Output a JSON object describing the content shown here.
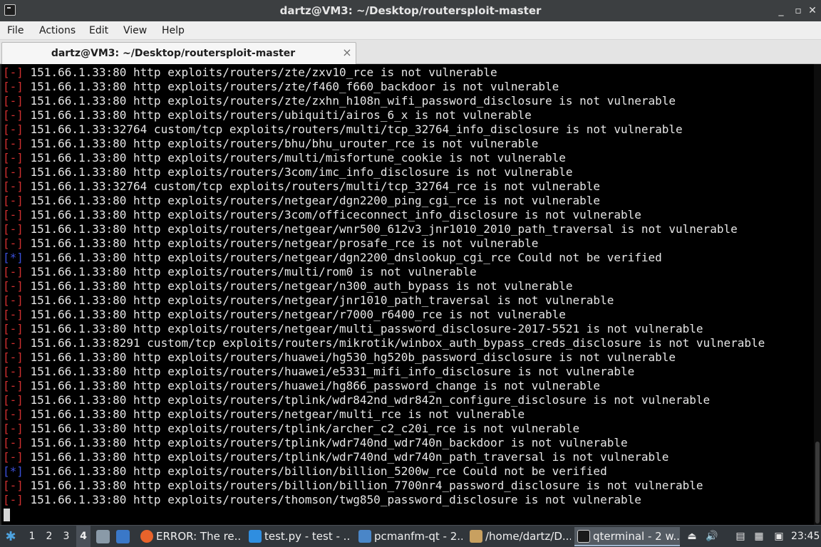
{
  "window": {
    "title": "dartz@VM3: ~/Desktop/routersploit-master",
    "minimize_glyph": "_",
    "maximize_glyph": "▫",
    "close_glyph": "✕"
  },
  "menu": [
    "File",
    "Actions",
    "Edit",
    "View",
    "Help"
  ],
  "tab": {
    "label": "dartz@VM3: ~/Desktop/routersploit-master",
    "close_glyph": "×"
  },
  "terminal": {
    "colors": {
      "error_prefix": "#d03030",
      "info_prefix": "#3a4fd8",
      "text": "#e6e6e6",
      "background": "#000000"
    },
    "lines": [
      {
        "prefix": "[-]",
        "kind": "err",
        "text": " 151.66.1.33:80 http exploits/routers/zte/zxv10_rce is not vulnerable"
      },
      {
        "prefix": "[-]",
        "kind": "err",
        "text": " 151.66.1.33:80 http exploits/routers/zte/f460_f660_backdoor is not vulnerable"
      },
      {
        "prefix": "[-]",
        "kind": "err",
        "text": " 151.66.1.33:80 http exploits/routers/zte/zxhn_h108n_wifi_password_disclosure is not vulnerable"
      },
      {
        "prefix": "[-]",
        "kind": "err",
        "text": " 151.66.1.33:80 http exploits/routers/ubiquiti/airos_6_x is not vulnerable"
      },
      {
        "prefix": "[-]",
        "kind": "err",
        "text": " 151.66.1.33:32764 custom/tcp exploits/routers/multi/tcp_32764_info_disclosure is not vulnerable"
      },
      {
        "prefix": "[-]",
        "kind": "err",
        "text": " 151.66.1.33:80 http exploits/routers/bhu/bhu_urouter_rce is not vulnerable"
      },
      {
        "prefix": "[-]",
        "kind": "err",
        "text": " 151.66.1.33:80 http exploits/routers/multi/misfortune_cookie is not vulnerable"
      },
      {
        "prefix": "[-]",
        "kind": "err",
        "text": " 151.66.1.33:80 http exploits/routers/3com/imc_info_disclosure is not vulnerable"
      },
      {
        "prefix": "[-]",
        "kind": "err",
        "text": " 151.66.1.33:32764 custom/tcp exploits/routers/multi/tcp_32764_rce is not vulnerable"
      },
      {
        "prefix": "[-]",
        "kind": "err",
        "text": " 151.66.1.33:80 http exploits/routers/netgear/dgn2200_ping_cgi_rce is not vulnerable"
      },
      {
        "prefix": "[-]",
        "kind": "err",
        "text": " 151.66.1.33:80 http exploits/routers/3com/officeconnect_info_disclosure is not vulnerable"
      },
      {
        "prefix": "[-]",
        "kind": "err",
        "text": " 151.66.1.33:80 http exploits/routers/netgear/wnr500_612v3_jnr1010_2010_path_traversal is not vulnerable"
      },
      {
        "prefix": "[-]",
        "kind": "err",
        "text": " 151.66.1.33:80 http exploits/routers/netgear/prosafe_rce is not vulnerable"
      },
      {
        "prefix": "[*]",
        "kind": "info",
        "text": " 151.66.1.33:80 http exploits/routers/netgear/dgn2200_dnslookup_cgi_rce Could not be verified"
      },
      {
        "prefix": "[-]",
        "kind": "err",
        "text": " 151.66.1.33:80 http exploits/routers/multi/rom0 is not vulnerable"
      },
      {
        "prefix": "[-]",
        "kind": "err",
        "text": " 151.66.1.33:80 http exploits/routers/netgear/n300_auth_bypass is not vulnerable"
      },
      {
        "prefix": "[-]",
        "kind": "err",
        "text": " 151.66.1.33:80 http exploits/routers/netgear/jnr1010_path_traversal is not vulnerable"
      },
      {
        "prefix": "[-]",
        "kind": "err",
        "text": " 151.66.1.33:80 http exploits/routers/netgear/r7000_r6400_rce is not vulnerable"
      },
      {
        "prefix": "[-]",
        "kind": "err",
        "text": " 151.66.1.33:80 http exploits/routers/netgear/multi_password_disclosure-2017-5521 is not vulnerable"
      },
      {
        "prefix": "[-]",
        "kind": "err",
        "text": " 151.66.1.33:8291 custom/tcp exploits/routers/mikrotik/winbox_auth_bypass_creds_disclosure is not vulnerable"
      },
      {
        "prefix": "[-]",
        "kind": "err",
        "text": " 151.66.1.33:80 http exploits/routers/huawei/hg530_hg520b_password_disclosure is not vulnerable"
      },
      {
        "prefix": "[-]",
        "kind": "err",
        "text": " 151.66.1.33:80 http exploits/routers/huawei/e5331_mifi_info_disclosure is not vulnerable"
      },
      {
        "prefix": "[-]",
        "kind": "err",
        "text": " 151.66.1.33:80 http exploits/routers/huawei/hg866_password_change is not vulnerable"
      },
      {
        "prefix": "[-]",
        "kind": "err",
        "text": " 151.66.1.33:80 http exploits/routers/tplink/wdr842nd_wdr842n_configure_disclosure is not vulnerable"
      },
      {
        "prefix": "[-]",
        "kind": "err",
        "text": " 151.66.1.33:80 http exploits/routers/netgear/multi_rce is not vulnerable"
      },
      {
        "prefix": "[-]",
        "kind": "err",
        "text": " 151.66.1.33:80 http exploits/routers/tplink/archer_c2_c20i_rce is not vulnerable"
      },
      {
        "prefix": "[-]",
        "kind": "err",
        "text": " 151.66.1.33:80 http exploits/routers/tplink/wdr740nd_wdr740n_backdoor is not vulnerable"
      },
      {
        "prefix": "[-]",
        "kind": "err",
        "text": " 151.66.1.33:80 http exploits/routers/tplink/wdr740nd_wdr740n_path_traversal is not vulnerable"
      },
      {
        "prefix": "[*]",
        "kind": "info",
        "text": " 151.66.1.33:80 http exploits/routers/billion/billion_5200w_rce Could not be verified"
      },
      {
        "prefix": "[-]",
        "kind": "err",
        "text": " 151.66.1.33:80 http exploits/routers/billion/billion_7700nr4_password_disclosure is not vulnerable"
      },
      {
        "prefix": "[-]",
        "kind": "err",
        "text": " 151.66.1.33:80 http exploits/routers/thomson/twg850_password_disclosure is not vulnerable"
      }
    ]
  },
  "taskbar": {
    "start_icon": "start-menu-icon",
    "desktops": [
      "1",
      "2",
      "3",
      "4"
    ],
    "active_desktop": "4",
    "tasks": [
      {
        "label": "ERROR: The re...",
        "icon": "firefox-icon",
        "color": "#e8632b"
      },
      {
        "label": "test.py - test - ...",
        "icon": "vscode-icon",
        "color": "#2f8ee0"
      },
      {
        "label": "pcmanfm-qt - 2...",
        "icon": "folder-icon",
        "color": "#4a86c8"
      },
      {
        "label": "/home/dartz/D...",
        "icon": "archive-icon",
        "color": "#c8a060"
      },
      {
        "label": "qterminal - 2 w...",
        "icon": "terminal-icon",
        "color": "#2a2a2a"
      }
    ],
    "clock": "23:45"
  }
}
